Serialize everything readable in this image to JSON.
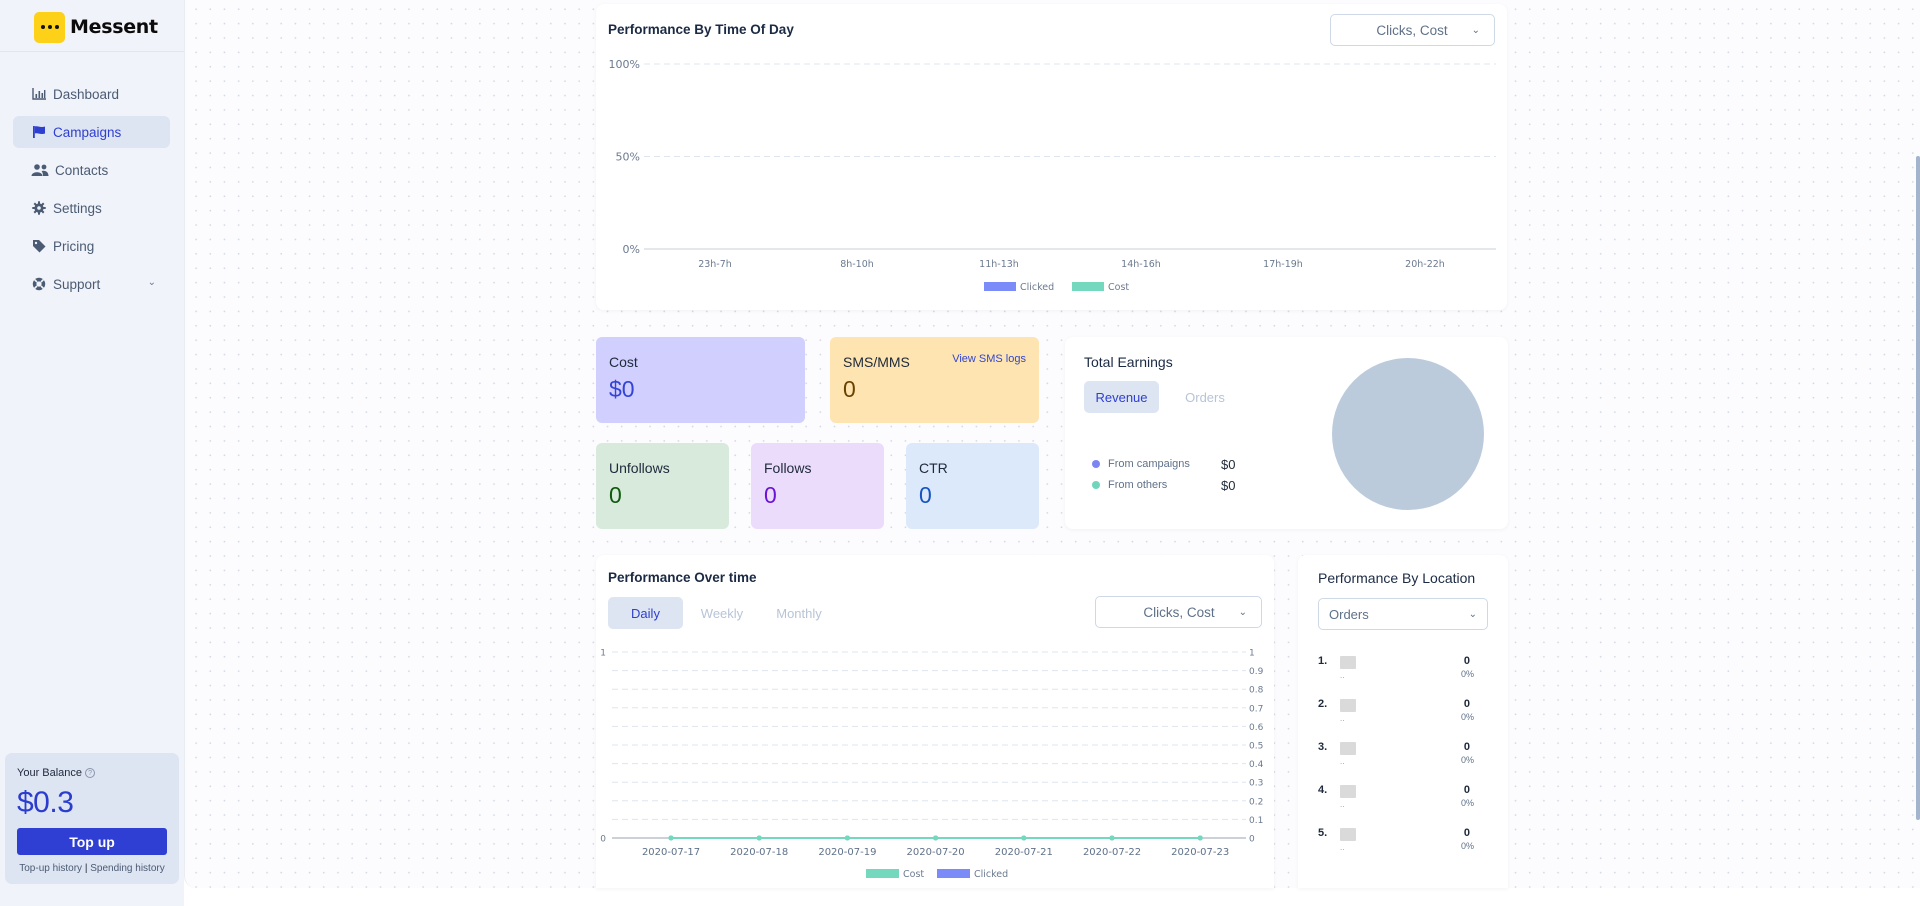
{
  "app": {
    "name": "Messent"
  },
  "sidebar": {
    "items": [
      {
        "label": "Dashboard",
        "icon": "bar-chart-icon",
        "active": false
      },
      {
        "label": "Campaigns",
        "icon": "flag-icon",
        "active": true
      },
      {
        "label": "Contacts",
        "icon": "users-icon",
        "active": false
      },
      {
        "label": "Settings",
        "icon": "gear-icon",
        "active": false
      },
      {
        "label": "Pricing",
        "icon": "tag-icon",
        "active": false
      },
      {
        "label": "Support",
        "icon": "lifebuoy-icon",
        "active": false,
        "has_submenu": true
      }
    ],
    "balance": {
      "label": "Your Balance",
      "help_icon": "?",
      "value": "$0.3",
      "topup_label": "Top up",
      "topup_history": "Top-up history",
      "separator": "|",
      "spending_history": "Spending history"
    }
  },
  "time_of_day": {
    "title": "Performance By Time Of Day",
    "metric_select": "Clicks, Cost",
    "chevron": "⌄"
  },
  "stats": {
    "cost": {
      "label": "Cost",
      "value": "$0"
    },
    "sms": {
      "label": "SMS/MMS",
      "value": "0",
      "link": "View SMS logs"
    },
    "unfollows": {
      "label": "Unfollows",
      "value": "0"
    },
    "follows": {
      "label": "Follows",
      "value": "0"
    },
    "ctr": {
      "label": "CTR",
      "value": "0"
    }
  },
  "earnings": {
    "title": "Total Earnings",
    "tabs": [
      {
        "label": "Revenue",
        "active": true
      },
      {
        "label": "Orders",
        "active": false
      }
    ],
    "legend": [
      {
        "label": "From campaigns",
        "value": "$0",
        "color": "#7b86f3"
      },
      {
        "label": "From others",
        "value": "$0",
        "color": "#6fd6bd"
      }
    ],
    "pie_empty_color": "#bccbdc"
  },
  "over_time": {
    "title": "Performance Over time",
    "tabs": [
      {
        "label": "Daily",
        "active": true
      },
      {
        "label": "Weekly",
        "active": false
      },
      {
        "label": "Monthly",
        "active": false
      }
    ],
    "metric_select": "Clicks, Cost"
  },
  "location": {
    "title": "Performance By Location",
    "select": "Orders",
    "rows": [
      {
        "rank": "1.",
        "name": "..",
        "value": "0",
        "pct": "0%"
      },
      {
        "rank": "2.",
        "name": "..",
        "value": "0",
        "pct": "0%"
      },
      {
        "rank": "3.",
        "name": "..",
        "value": "0",
        "pct": "0%"
      },
      {
        "rank": "4.",
        "name": "..",
        "value": "0",
        "pct": "0%"
      },
      {
        "rank": "5.",
        "name": "..",
        "value": "0",
        "pct": "0%"
      }
    ]
  },
  "chart_data": [
    {
      "type": "bar",
      "title": "Performance By Time Of Day",
      "categories": [
        "23h-7h",
        "8h-10h",
        "11h-13h",
        "14h-16h",
        "17h-19h",
        "20h-22h"
      ],
      "series": [
        {
          "name": "Clicked",
          "color": "#7b8cf8",
          "values": [
            0,
            0,
            0,
            0,
            0,
            0
          ]
        },
        {
          "name": "Cost",
          "color": "#74d8bf",
          "values": [
            0,
            0,
            0,
            0,
            0,
            0
          ]
        }
      ],
      "yticks": [
        "0%",
        "50%",
        "100%"
      ],
      "ylim": [
        0,
        100
      ],
      "grid": true,
      "legend": "bottom"
    },
    {
      "type": "line",
      "title": "Performance Over time",
      "x": [
        "2020-07-17",
        "2020-07-18",
        "2020-07-19",
        "2020-07-20",
        "2020-07-21",
        "2020-07-22",
        "2020-07-23"
      ],
      "series": [
        {
          "name": "Cost",
          "color": "#74d8bf",
          "values": [
            0,
            0,
            0,
            0,
            0,
            0,
            0
          ]
        },
        {
          "name": "Clicked",
          "color": "#7b8cf8",
          "values": [
            0,
            0,
            0,
            0,
            0,
            0,
            0
          ]
        }
      ],
      "yticks_left": [
        "0",
        "1"
      ],
      "yticks_right": [
        "0",
        "0.1",
        "0.2",
        "0.3",
        "0.4",
        "0.5",
        "0.6",
        "0.7",
        "0.8",
        "0.9",
        "1"
      ],
      "ylim": [
        0,
        1
      ],
      "grid": true,
      "legend": "bottom"
    },
    {
      "type": "pie",
      "title": "Total Earnings",
      "labels": [
        "From campaigns",
        "From others"
      ],
      "values": [
        0,
        0
      ]
    }
  ]
}
